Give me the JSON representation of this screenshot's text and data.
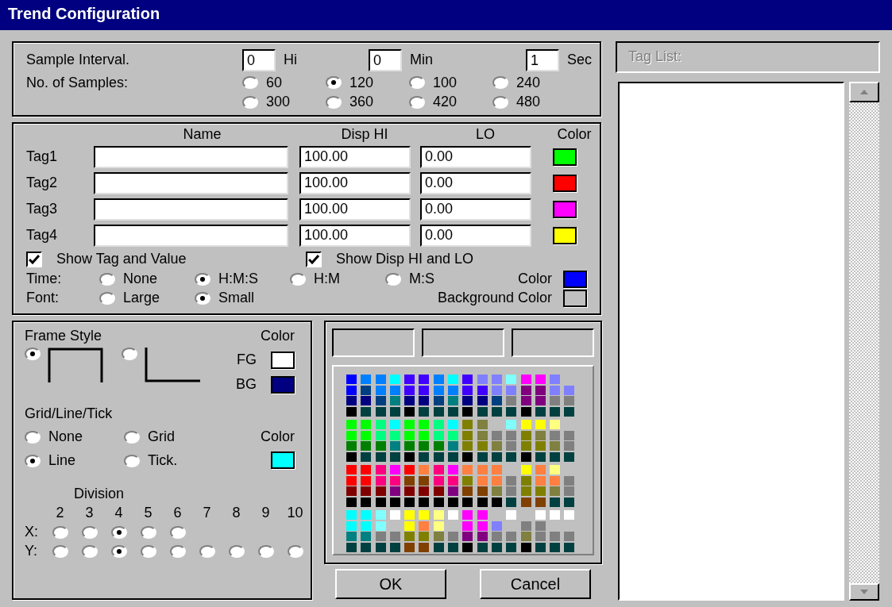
{
  "window": {
    "title": "Trend Configuration"
  },
  "sample_interval": {
    "label": "Sample Interval.",
    "fields": [
      {
        "value": "0",
        "unit": "Hi"
      },
      {
        "value": "0",
        "unit": "Min"
      },
      {
        "value": "1",
        "unit": "Sec"
      }
    ]
  },
  "samples": {
    "label": "No. of Samples:",
    "options": [
      {
        "label": "60",
        "selected": false
      },
      {
        "label": "120",
        "selected": true
      },
      {
        "label": "100",
        "selected": false
      },
      {
        "label": "240",
        "selected": false
      },
      {
        "label": "300",
        "selected": false
      },
      {
        "label": "360",
        "selected": false
      },
      {
        "label": "420",
        "selected": false
      },
      {
        "label": "480",
        "selected": false
      }
    ]
  },
  "tag_table": {
    "columns": [
      "Name",
      "Disp HI",
      "LO",
      "Color"
    ],
    "rows": [
      {
        "label": "Tag1",
        "hi": "100.00",
        "lo": "0.00",
        "color": "#00ff00"
      },
      {
        "label": "Tag2",
        "hi": "100.00",
        "lo": "0.00",
        "color": "#ff0000"
      },
      {
        "label": "Tag3",
        "hi": "100.00",
        "lo": "0.00",
        "color": "#ff00ff"
      },
      {
        "label": "Tag4",
        "hi": "100.00",
        "lo": "0.00",
        "color": "#ffff00"
      }
    ]
  },
  "show_options": [
    {
      "label": "Show Tag and Value",
      "checked": true
    },
    {
      "label": "Show Disp HI and LO",
      "checked": true
    }
  ],
  "time": {
    "label": "Time:",
    "options": [
      {
        "label": "None",
        "selected": false
      },
      {
        "label": "H:M:S",
        "selected": true
      },
      {
        "label": "H:M",
        "selected": false
      },
      {
        "label": "M:S",
        "selected": false
      }
    ],
    "color_label": "Color",
    "color": "#0000ff"
  },
  "font": {
    "label": "Font:",
    "options": [
      {
        "label": "Large",
        "selected": false
      },
      {
        "label": "Small",
        "selected": true
      }
    ],
    "background": {
      "label": "Background Color",
      "color": "#c0c0c0"
    }
  },
  "frame": {
    "title": "Frame Style",
    "options": [
      {
        "kind": "box",
        "selected": true
      },
      {
        "kind": "corner",
        "selected": false
      }
    ],
    "color_label": "Color",
    "fg": {
      "label": "FG",
      "color": "#ffffff"
    },
    "bg": {
      "label": "BG",
      "color": "#000080"
    }
  },
  "grid": {
    "title": "Grid/Line/Tick",
    "options": [
      {
        "label": "None",
        "selected": false
      },
      {
        "label": "Grid",
        "selected": false
      },
      {
        "label": "Line",
        "selected": true
      },
      {
        "label": "Tick.",
        "selected": false
      }
    ],
    "color_label": "Color",
    "color": "#00ffff"
  },
  "division": {
    "title": "Division",
    "numbers": [
      "2",
      "3",
      "4",
      "5",
      "6",
      "7",
      "8",
      "9",
      "10"
    ],
    "x": {
      "label": "X:",
      "options": [
        {
          "selected": false
        },
        {
          "selected": false
        },
        {
          "selected": true
        },
        {
          "selected": false
        },
        {
          "selected": false
        }
      ]
    },
    "y": {
      "label": "Y:",
      "options": [
        {
          "selected": false
        },
        {
          "selected": false
        },
        {
          "selected": true
        },
        {
          "selected": false
        },
        {
          "selected": false
        },
        {
          "selected": false
        },
        {
          "selected": false
        },
        {
          "selected": false
        },
        {
          "selected": false
        }
      ]
    }
  },
  "palette": {
    "rows": [
      [
        {
          "kind": "swatch",
          "color": "#0000ff"
        },
        {
          "kind": "swatch",
          "color": "#0080ff"
        },
        {
          "kind": "swatch",
          "color": "#0080ff"
        },
        {
          "kind": "swatch",
          "color": "#00ffff"
        },
        {
          "kind": "swatch",
          "color": "#4000ff"
        },
        {
          "kind": "swatch",
          "color": "#4000ff"
        },
        {
          "kind": "swatch",
          "color": "#0080ff"
        },
        {
          "kind": "swatch",
          "color": "#00ffff"
        },
        {
          "kind": "swatch",
          "color": "#4000ff"
        },
        {
          "kind": "swatch",
          "color": "#8080ff"
        },
        {
          "kind": "swatch",
          "color": "#8080ff"
        },
        {
          "kind": "swatch",
          "color": "#80ffff"
        },
        {
          "kind": "swatch",
          "color": "#ff00ff"
        },
        {
          "kind": "swatch",
          "color": "#ff00ff"
        },
        {
          "kind": "swatch",
          "color": "#8080ff"
        },
        {
          "kind": "empty"
        }
      ],
      [
        {
          "kind": "swatch",
          "color": "#0000ff"
        },
        {
          "kind": "swatch",
          "color": "#004080"
        },
        {
          "kind": "swatch",
          "color": "#0080ff"
        },
        {
          "kind": "swatch",
          "color": "#0080ff"
        },
        {
          "kind": "swatch",
          "color": "#4000ff"
        },
        {
          "kind": "swatch",
          "color": "#4000ff"
        },
        {
          "kind": "swatch",
          "color": "#0080ff"
        },
        {
          "kind": "swatch",
          "color": "#0080ff"
        },
        {
          "kind": "swatch",
          "color": "#4000ff"
        },
        {
          "kind": "swatch",
          "color": "#4000ff"
        },
        {
          "kind": "swatch",
          "color": "#8080ff"
        },
        {
          "kind": "swatch",
          "color": "#8080ff"
        },
        {
          "kind": "swatch",
          "color": "#800080"
        },
        {
          "kind": "swatch",
          "color": "#800080"
        },
        {
          "kind": "swatch",
          "color": "#8080ff"
        },
        {
          "kind": "swatch",
          "color": "#8080ff"
        }
      ],
      [
        {
          "kind": "swatch",
          "color": "#000080"
        },
        {
          "kind": "swatch",
          "color": "#000080"
        },
        {
          "kind": "swatch",
          "color": "#004080"
        },
        {
          "kind": "swatch",
          "color": "#008080"
        },
        {
          "kind": "swatch",
          "color": "#000080"
        },
        {
          "kind": "swatch",
          "color": "#000080"
        },
        {
          "kind": "swatch",
          "color": "#004080"
        },
        {
          "kind": "swatch",
          "color": "#008080"
        },
        {
          "kind": "swatch",
          "color": "#000080"
        },
        {
          "kind": "swatch",
          "color": "#000080"
        },
        {
          "kind": "swatch",
          "color": "#004080"
        },
        {
          "kind": "swatch",
          "color": "#808080"
        },
        {
          "kind": "swatch",
          "color": "#800080"
        },
        {
          "kind": "swatch",
          "color": "#800080"
        },
        {
          "kind": "swatch",
          "color": "#808080"
        },
        {
          "kind": "swatch",
          "color": "#808080"
        }
      ],
      [
        {
          "kind": "swatch",
          "color": "#000000"
        },
        {
          "kind": "swatch",
          "color": "#004040"
        },
        {
          "kind": "swatch",
          "color": "#004040"
        },
        {
          "kind": "swatch",
          "color": "#004040"
        },
        {
          "kind": "swatch",
          "color": "#000000"
        },
        {
          "kind": "swatch",
          "color": "#004040"
        },
        {
          "kind": "swatch",
          "color": "#004040"
        },
        {
          "kind": "swatch",
          "color": "#004040"
        },
        {
          "kind": "swatch",
          "color": "#000000"
        },
        {
          "kind": "swatch",
          "color": "#004040"
        },
        {
          "kind": "swatch",
          "color": "#004040"
        },
        {
          "kind": "swatch",
          "color": "#004040"
        },
        {
          "kind": "swatch",
          "color": "#000000"
        },
        {
          "kind": "swatch",
          "color": "#004040"
        },
        {
          "kind": "swatch",
          "color": "#004040"
        },
        {
          "kind": "swatch",
          "color": "#004040"
        }
      ],
      [
        {
          "kind": "swatch",
          "color": "#00ff00"
        },
        {
          "kind": "swatch",
          "color": "#00ff00"
        },
        {
          "kind": "swatch",
          "color": "#00ff80"
        },
        {
          "kind": "swatch",
          "color": "#00ffff"
        },
        {
          "kind": "swatch",
          "color": "#00ff00"
        },
        {
          "kind": "swatch",
          "color": "#00ff00"
        },
        {
          "kind": "swatch",
          "color": "#00ff80"
        },
        {
          "kind": "swatch",
          "color": "#00ffff"
        },
        {
          "kind": "swatch",
          "color": "#808000"
        },
        {
          "kind": "swatch",
          "color": "#808040"
        },
        {
          "kind": "empty"
        },
        {
          "kind": "swatch",
          "color": "#80ffff"
        },
        {
          "kind": "swatch",
          "color": "#ffff00"
        },
        {
          "kind": "swatch",
          "color": "#ffff00"
        },
        {
          "kind": "swatch",
          "color": "#ffff80"
        },
        {
          "kind": "empty"
        }
      ],
      [
        {
          "kind": "swatch",
          "color": "#00ff00"
        },
        {
          "kind": "swatch",
          "color": "#00ff00"
        },
        {
          "kind": "swatch",
          "color": "#00ff80"
        },
        {
          "kind": "swatch",
          "color": "#00ff80"
        },
        {
          "kind": "swatch",
          "color": "#00ff00"
        },
        {
          "kind": "swatch",
          "color": "#00ff00"
        },
        {
          "kind": "swatch",
          "color": "#00ff80"
        },
        {
          "kind": "swatch",
          "color": "#00ff80"
        },
        {
          "kind": "swatch",
          "color": "#808000"
        },
        {
          "kind": "swatch",
          "color": "#808040"
        },
        {
          "kind": "swatch",
          "color": "#808080"
        },
        {
          "kind": "swatch",
          "color": "#808080"
        },
        {
          "kind": "swatch",
          "color": "#808000"
        },
        {
          "kind": "swatch",
          "color": "#808040"
        },
        {
          "kind": "swatch",
          "color": "#808080"
        },
        {
          "kind": "swatch",
          "color": "#808080"
        }
      ],
      [
        {
          "kind": "swatch",
          "color": "#008000"
        },
        {
          "kind": "swatch",
          "color": "#008000"
        },
        {
          "kind": "swatch",
          "color": "#008000"
        },
        {
          "kind": "swatch",
          "color": "#008080"
        },
        {
          "kind": "swatch",
          "color": "#008000"
        },
        {
          "kind": "swatch",
          "color": "#008000"
        },
        {
          "kind": "swatch",
          "color": "#008000"
        },
        {
          "kind": "swatch",
          "color": "#008080"
        },
        {
          "kind": "swatch",
          "color": "#808000"
        },
        {
          "kind": "swatch",
          "color": "#808000"
        },
        {
          "kind": "swatch",
          "color": "#808040"
        },
        {
          "kind": "swatch",
          "color": "#808080"
        },
        {
          "kind": "swatch",
          "color": "#808000"
        },
        {
          "kind": "swatch",
          "color": "#808000"
        },
        {
          "kind": "swatch",
          "color": "#808040"
        },
        {
          "kind": "swatch",
          "color": "#808080"
        }
      ],
      [
        {
          "kind": "swatch",
          "color": "#000000"
        },
        {
          "kind": "swatch",
          "color": "#004040"
        },
        {
          "kind": "swatch",
          "color": "#004040"
        },
        {
          "kind": "swatch",
          "color": "#004040"
        },
        {
          "kind": "swatch",
          "color": "#000000"
        },
        {
          "kind": "swatch",
          "color": "#004040"
        },
        {
          "kind": "swatch",
          "color": "#004040"
        },
        {
          "kind": "swatch",
          "color": "#004040"
        },
        {
          "kind": "swatch",
          "color": "#000000"
        },
        {
          "kind": "swatch",
          "color": "#004040"
        },
        {
          "kind": "swatch",
          "color": "#004040"
        },
        {
          "kind": "swatch",
          "color": "#004040"
        },
        {
          "kind": "swatch",
          "color": "#000000"
        },
        {
          "kind": "swatch",
          "color": "#004040"
        },
        {
          "kind": "swatch",
          "color": "#004040"
        },
        {
          "kind": "swatch",
          "color": "#004040"
        }
      ],
      [
        {
          "kind": "swatch",
          "color": "#ff0000"
        },
        {
          "kind": "swatch",
          "color": "#ff0000"
        },
        {
          "kind": "swatch",
          "color": "#ff0080"
        },
        {
          "kind": "swatch",
          "color": "#ff00ff"
        },
        {
          "kind": "swatch",
          "color": "#ff0000"
        },
        {
          "kind": "swatch",
          "color": "#ff8040"
        },
        {
          "kind": "swatch",
          "color": "#ff0080"
        },
        {
          "kind": "swatch",
          "color": "#ff00ff"
        },
        {
          "kind": "swatch",
          "color": "#ff8040"
        },
        {
          "kind": "swatch",
          "color": "#ff8040"
        },
        {
          "kind": "swatch",
          "color": "#ff8040"
        },
        {
          "kind": "empty"
        },
        {
          "kind": "swatch",
          "color": "#ffff00"
        },
        {
          "kind": "swatch",
          "color": "#ff8040"
        },
        {
          "kind": "swatch",
          "color": "#ffff80"
        },
        {
          "kind": "empty"
        }
      ],
      [
        {
          "kind": "swatch",
          "color": "#ff0000"
        },
        {
          "kind": "swatch",
          "color": "#ff0000"
        },
        {
          "kind": "swatch",
          "color": "#ff0080"
        },
        {
          "kind": "swatch",
          "color": "#ff0080"
        },
        {
          "kind": "swatch",
          "color": "#804000"
        },
        {
          "kind": "swatch",
          "color": "#804000"
        },
        {
          "kind": "swatch",
          "color": "#ff0080"
        },
        {
          "kind": "swatch",
          "color": "#ff0080"
        },
        {
          "kind": "swatch",
          "color": "#808000"
        },
        {
          "kind": "swatch",
          "color": "#ff8040"
        },
        {
          "kind": "swatch",
          "color": "#ff8040"
        },
        {
          "kind": "swatch",
          "color": "#808080"
        },
        {
          "kind": "swatch",
          "color": "#808000"
        },
        {
          "kind": "swatch",
          "color": "#ff8040"
        },
        {
          "kind": "swatch",
          "color": "#ff8040"
        },
        {
          "kind": "swatch",
          "color": "#808080"
        }
      ],
      [
        {
          "kind": "swatch",
          "color": "#800000"
        },
        {
          "kind": "swatch",
          "color": "#800000"
        },
        {
          "kind": "swatch",
          "color": "#800000"
        },
        {
          "kind": "swatch",
          "color": "#800080"
        },
        {
          "kind": "swatch",
          "color": "#800000"
        },
        {
          "kind": "swatch",
          "color": "#800000"
        },
        {
          "kind": "swatch",
          "color": "#800000"
        },
        {
          "kind": "swatch",
          "color": "#800080"
        },
        {
          "kind": "swatch",
          "color": "#804000"
        },
        {
          "kind": "swatch",
          "color": "#804000"
        },
        {
          "kind": "swatch",
          "color": "#808040"
        },
        {
          "kind": "swatch",
          "color": "#808080"
        },
        {
          "kind": "swatch",
          "color": "#808000"
        },
        {
          "kind": "swatch",
          "color": "#808000"
        },
        {
          "kind": "swatch",
          "color": "#808040"
        },
        {
          "kind": "swatch",
          "color": "#808080"
        }
      ],
      [
        {
          "kind": "swatch",
          "color": "#000000"
        },
        {
          "kind": "swatch",
          "color": "#000000"
        },
        {
          "kind": "swatch",
          "color": "#000000"
        },
        {
          "kind": "swatch",
          "color": "#000000"
        },
        {
          "kind": "swatch",
          "color": "#000000"
        },
        {
          "kind": "swatch",
          "color": "#000000"
        },
        {
          "kind": "swatch",
          "color": "#000000"
        },
        {
          "kind": "swatch",
          "color": "#000000"
        },
        {
          "kind": "swatch",
          "color": "#000000"
        },
        {
          "kind": "swatch",
          "color": "#000000"
        },
        {
          "kind": "swatch",
          "color": "#000000"
        },
        {
          "kind": "swatch",
          "color": "#004040"
        },
        {
          "kind": "swatch",
          "color": "#804000"
        },
        {
          "kind": "swatch",
          "color": "#804000"
        },
        {
          "kind": "swatch",
          "color": "#004040"
        },
        {
          "kind": "swatch",
          "color": "#004040"
        }
      ],
      [
        {
          "kind": "swatch",
          "color": "#00ffff"
        },
        {
          "kind": "swatch",
          "color": "#00ffff"
        },
        {
          "kind": "swatch",
          "color": "#80ffff"
        },
        {
          "kind": "swatch",
          "color": "#ffffff"
        },
        {
          "kind": "swatch",
          "color": "#ffff00"
        },
        {
          "kind": "swatch",
          "color": "#ffff00"
        },
        {
          "kind": "swatch",
          "color": "#ffff80"
        },
        {
          "kind": "swatch",
          "color": "#ffffff"
        },
        {
          "kind": "swatch",
          "color": "#ff00ff"
        },
        {
          "kind": "swatch",
          "color": "#ff00ff"
        },
        {
          "kind": "empty"
        },
        {
          "kind": "swatch",
          "color": "#ffffff"
        },
        {
          "kind": "empty"
        },
        {
          "kind": "swatch",
          "color": "#ffffff"
        },
        {
          "kind": "swatch",
          "color": "#ffffff"
        },
        {
          "kind": "swatch",
          "color": "#ffffff"
        }
      ],
      [
        {
          "kind": "swatch",
          "color": "#00ffff"
        },
        {
          "kind": "swatch",
          "color": "#00ffff"
        },
        {
          "kind": "swatch",
          "color": "#80ffff"
        },
        {
          "kind": "empty"
        },
        {
          "kind": "swatch",
          "color": "#ffff00"
        },
        {
          "kind": "swatch",
          "color": "#ff8040"
        },
        {
          "kind": "swatch",
          "color": "#ffff80"
        },
        {
          "kind": "empty"
        },
        {
          "kind": "swatch",
          "color": "#ff00ff"
        },
        {
          "kind": "swatch",
          "color": "#ff00ff"
        },
        {
          "kind": "swatch",
          "color": "#8080ff"
        },
        {
          "kind": "empty"
        },
        {
          "kind": "swatch",
          "color": "#808080"
        },
        {
          "kind": "swatch",
          "color": "#808080"
        },
        {
          "kind": "empty"
        },
        {
          "kind": "empty"
        }
      ],
      [
        {
          "kind": "swatch",
          "color": "#008080"
        },
        {
          "kind": "swatch",
          "color": "#008080"
        },
        {
          "kind": "swatch",
          "color": "#808080"
        },
        {
          "kind": "swatch",
          "color": "#808080"
        },
        {
          "kind": "swatch",
          "color": "#808000"
        },
        {
          "kind": "swatch",
          "color": "#808000"
        },
        {
          "kind": "swatch",
          "color": "#808040"
        },
        {
          "kind": "swatch",
          "color": "#808080"
        },
        {
          "kind": "swatch",
          "color": "#800080"
        },
        {
          "kind": "swatch",
          "color": "#800080"
        },
        {
          "kind": "swatch",
          "color": "#808080"
        },
        {
          "kind": "swatch",
          "color": "#808080"
        },
        {
          "kind": "swatch",
          "color": "#808040"
        },
        {
          "kind": "swatch",
          "color": "#808080"
        },
        {
          "kind": "swatch",
          "color": "#808080"
        },
        {
          "kind": "swatch",
          "color": "#808080"
        }
      ],
      [
        {
          "kind": "swatch",
          "color": "#004040"
        },
        {
          "kind": "swatch",
          "color": "#004040"
        },
        {
          "kind": "swatch",
          "color": "#004040"
        },
        {
          "kind": "swatch",
          "color": "#004040"
        },
        {
          "kind": "swatch",
          "color": "#804000"
        },
        {
          "kind": "swatch",
          "color": "#804000"
        },
        {
          "kind": "swatch",
          "color": "#004040"
        },
        {
          "kind": "swatch",
          "color": "#004040"
        },
        {
          "kind": "swatch",
          "color": "#000000"
        },
        {
          "kind": "swatch",
          "color": "#004040"
        },
        {
          "kind": "swatch",
          "color": "#004040"
        },
        {
          "kind": "swatch",
          "color": "#004040"
        },
        {
          "kind": "swatch",
          "color": "#000000"
        },
        {
          "kind": "swatch",
          "color": "#004040"
        },
        {
          "kind": "swatch",
          "color": "#004040"
        },
        {
          "kind": "swatch",
          "color": "#004040"
        }
      ]
    ]
  },
  "buttons": [
    {
      "label": "OK"
    },
    {
      "label": "Cancel"
    }
  ],
  "tag_list": {
    "label": "Tag List:",
    "disabled": true
  }
}
